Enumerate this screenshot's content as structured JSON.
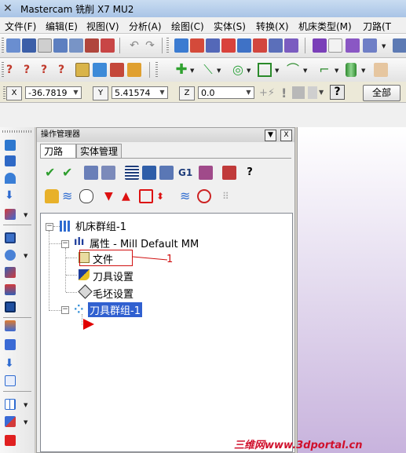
{
  "window": {
    "title": "Mastercam 铣削 X7 MU2"
  },
  "menu": [
    "文件(F)",
    "编辑(E)",
    "视图(V)",
    "分析(A)",
    "绘图(C)",
    "实体(S)",
    "转换(X)",
    "机床类型(M)",
    "刀路(T"
  ],
  "coordbar": {
    "x_key": "X",
    "x_value": "-36.7819",
    "y_key": "Y",
    "y_value": "5.41574",
    "z_key": "Z",
    "z_value": "0.0",
    "all_button": "全部"
  },
  "ops_manager": {
    "title": "操作管理器",
    "tabs": [
      "刀路",
      "实体管理"
    ],
    "tree": {
      "machine_group": "机床群组-1",
      "properties": "属性 - Mill Default MM",
      "files": "文件",
      "tool_settings": "刀具设置",
      "stock_settings": "毛坯设置",
      "toolpath_group": "刀具群组-1"
    },
    "g1_label": "G1"
  },
  "annotation": {
    "label": "1",
    "color": "#d01010"
  },
  "watermark": "三维网www.3dportal.cn"
}
